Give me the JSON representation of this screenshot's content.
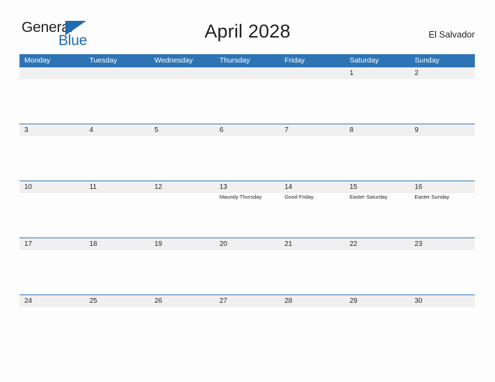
{
  "header": {
    "logo": {
      "primary": "General",
      "secondary": "Blue",
      "triangle_icon": "triangle-icon",
      "primary_color": "#231f20",
      "secondary_color": "#1f6cb0"
    },
    "title": "April 2028",
    "region": "El Salvador"
  },
  "calendar": {
    "header_color": "#2e74b5",
    "band_color": "#f0f0f0",
    "weekdays": [
      "Monday",
      "Tuesday",
      "Wednesday",
      "Thursday",
      "Friday",
      "Saturday",
      "Sunday"
    ],
    "weeks": [
      [
        {
          "day": "",
          "event": ""
        },
        {
          "day": "",
          "event": ""
        },
        {
          "day": "",
          "event": ""
        },
        {
          "day": "",
          "event": ""
        },
        {
          "day": "",
          "event": ""
        },
        {
          "day": "1",
          "event": ""
        },
        {
          "day": "2",
          "event": ""
        }
      ],
      [
        {
          "day": "3",
          "event": ""
        },
        {
          "day": "4",
          "event": ""
        },
        {
          "day": "5",
          "event": ""
        },
        {
          "day": "6",
          "event": ""
        },
        {
          "day": "7",
          "event": ""
        },
        {
          "day": "8",
          "event": ""
        },
        {
          "day": "9",
          "event": ""
        }
      ],
      [
        {
          "day": "10",
          "event": ""
        },
        {
          "day": "11",
          "event": ""
        },
        {
          "day": "12",
          "event": ""
        },
        {
          "day": "13",
          "event": "Maundy Thursday"
        },
        {
          "day": "14",
          "event": "Good Friday"
        },
        {
          "day": "15",
          "event": "Easter Saturday"
        },
        {
          "day": "16",
          "event": "Easter Sunday"
        }
      ],
      [
        {
          "day": "17",
          "event": ""
        },
        {
          "day": "18",
          "event": ""
        },
        {
          "day": "19",
          "event": ""
        },
        {
          "day": "20",
          "event": ""
        },
        {
          "day": "21",
          "event": ""
        },
        {
          "day": "22",
          "event": ""
        },
        {
          "day": "23",
          "event": ""
        }
      ],
      [
        {
          "day": "24",
          "event": ""
        },
        {
          "day": "25",
          "event": ""
        },
        {
          "day": "26",
          "event": ""
        },
        {
          "day": "27",
          "event": ""
        },
        {
          "day": "28",
          "event": ""
        },
        {
          "day": "29",
          "event": ""
        },
        {
          "day": "30",
          "event": ""
        }
      ]
    ]
  }
}
